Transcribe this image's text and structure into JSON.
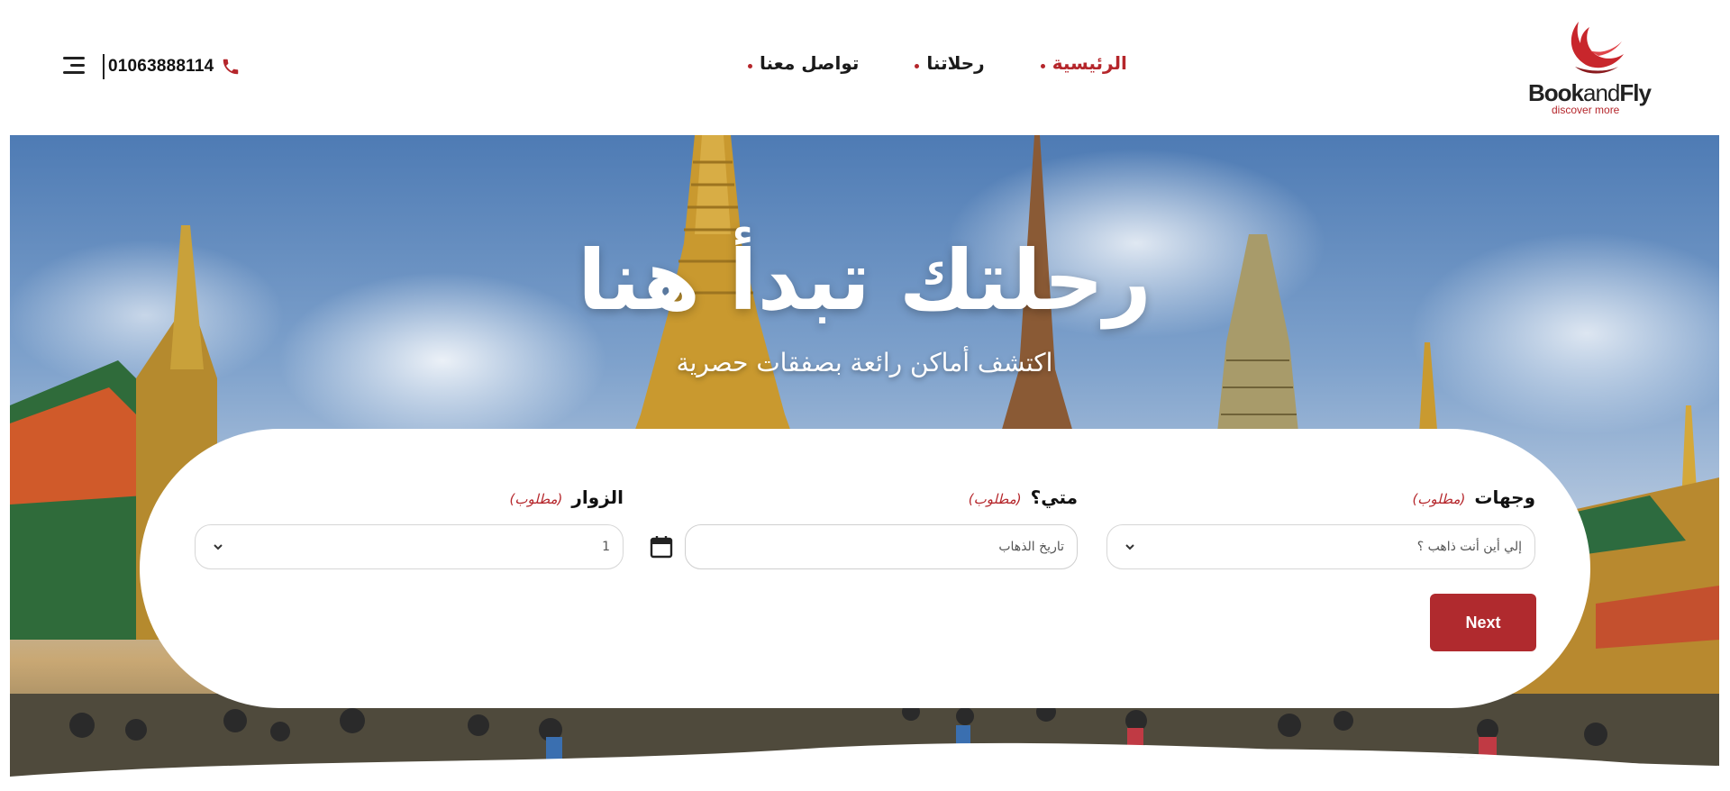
{
  "header": {
    "logo": {
      "text_bold": "Book",
      "text_thin": "and",
      "text_bold2": "Fly",
      "tagline": "discover more"
    },
    "nav": [
      {
        "label": "الرئيسية",
        "active": true
      },
      {
        "label": "رحلاتنا",
        "active": false
      },
      {
        "label": "تواصل معنا",
        "active": false
      }
    ],
    "phone": "01063888114",
    "icons": {
      "menu": "hamburger-menu-icon",
      "phone": "phone-icon"
    }
  },
  "hero": {
    "title": "رحلتك تبدأ هنا",
    "subtitle": "اكتشف أماكن رائعة بصفقات حصرية"
  },
  "search": {
    "destination": {
      "label": "وجهات",
      "required": "(مطلوب)",
      "placeholder": "إلي أين أنت ذاهب ؟"
    },
    "date": {
      "label": "متي؟",
      "required": "(مطلوب)",
      "placeholder": "تاريخ الذهاب"
    },
    "visitors": {
      "label": "الزوار",
      "required": "(مطلوب)",
      "value": "1"
    },
    "next_label": "Next"
  },
  "colors": {
    "accent": "#b5262b",
    "button": "#b02a2e",
    "text": "#1a1a1a"
  }
}
